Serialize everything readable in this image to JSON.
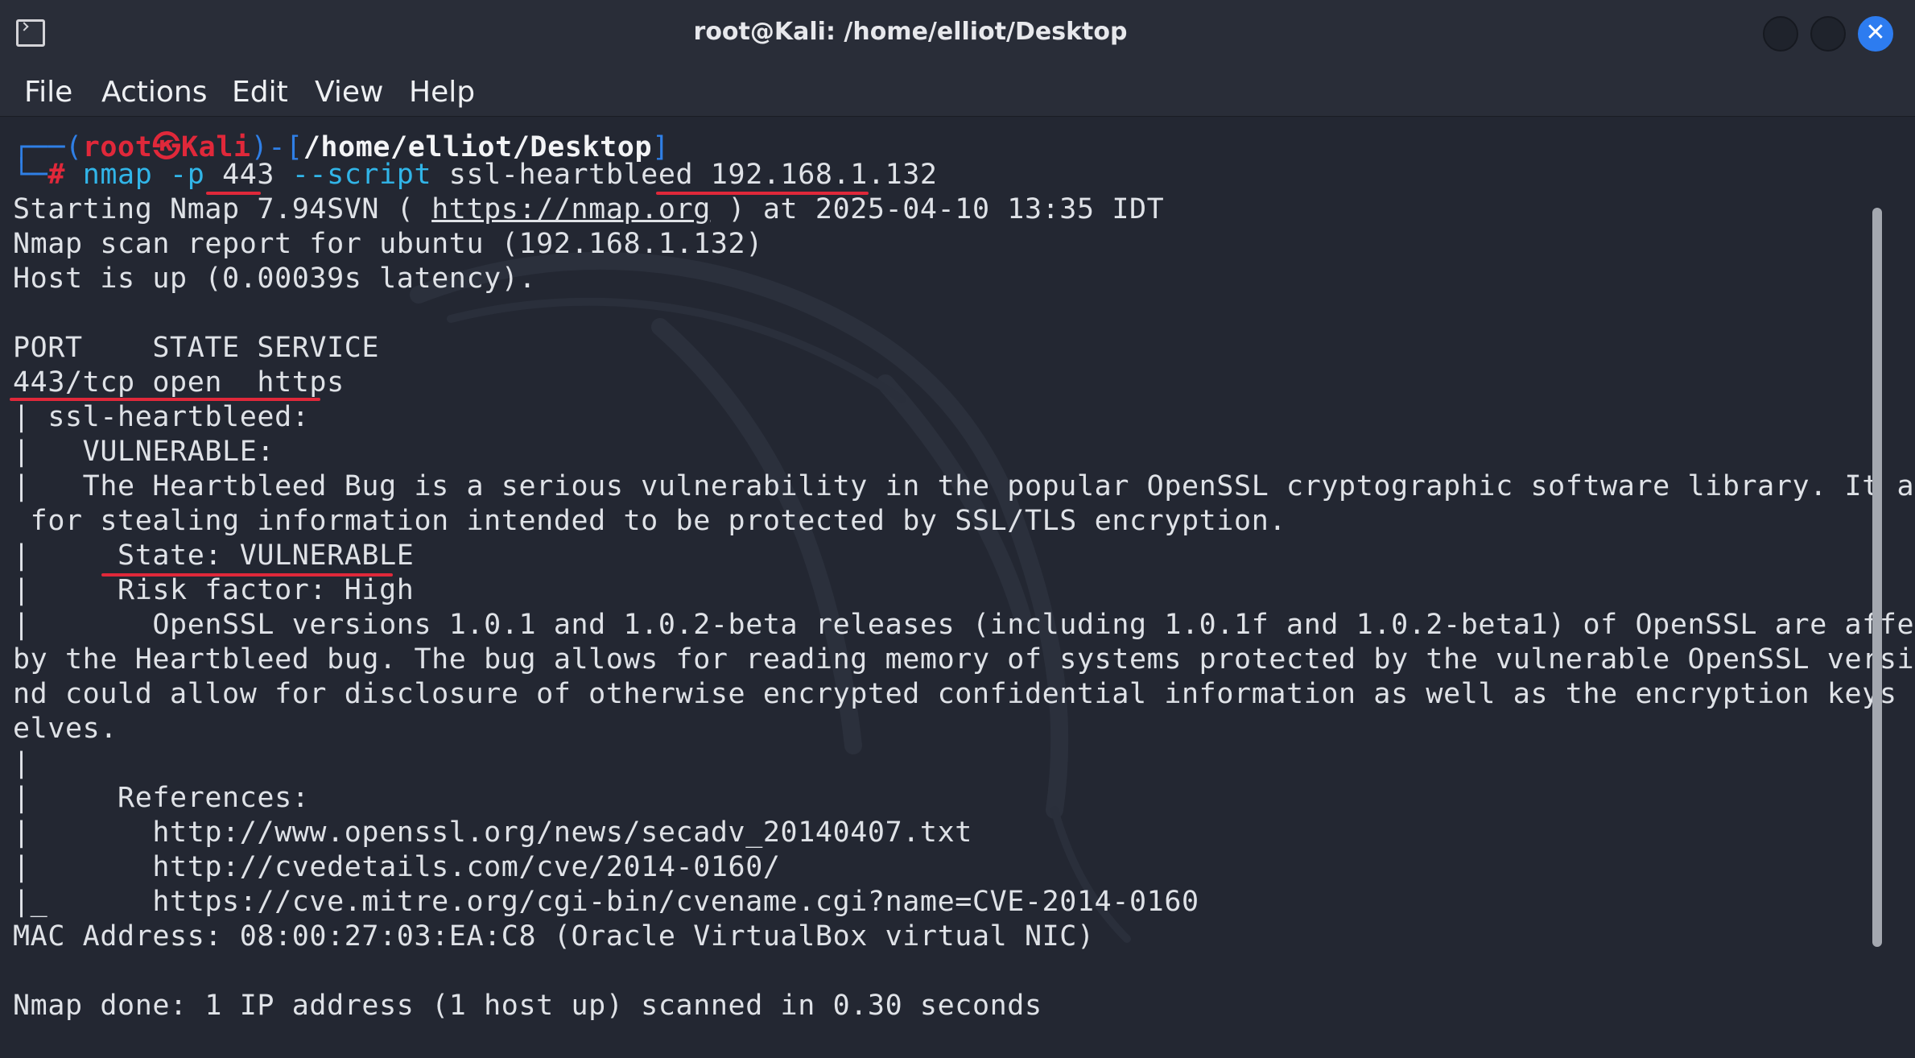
{
  "window": {
    "title": "root@Kali: /home/elliot/Desktop",
    "close_glyph": "✕"
  },
  "menu": {
    "items": [
      "File",
      "Actions",
      "Edit",
      "View",
      "Help"
    ]
  },
  "prompt": {
    "corner_top": "┌──(",
    "user": "root",
    "at_symbol": "㉿",
    "host": "Kali",
    "mid": ")-[",
    "cwd": "/home/elliot/Desktop",
    "end": "]",
    "corner_bottom": "└─",
    "hash": "#",
    "cmd": "nmap",
    "arg1": "-p",
    "port": "443",
    "arg2": "--script",
    "script": "ssl-heartbleed",
    "target": "192.168.1.132"
  },
  "output": {
    "start_pre": "Starting Nmap 7.94SVN ( ",
    "start_url": "https://nmap.org",
    "start_post": " ) at 2025-04-10 13:35 IDT",
    "lines": [
      "Nmap scan report for ubuntu (192.168.1.132)",
      "Host is up (0.00039s latency).",
      "",
      "PORT    STATE SERVICE",
      "443/tcp open  https",
      "| ssl-heartbleed: ",
      "|   VULNERABLE:",
      "|   The Heartbleed Bug is a serious vulnerability in the popular OpenSSL cryptographic software library. It allows",
      " for stealing information intended to be protected by SSL/TLS encryption.",
      "|     State: VULNERABLE",
      "|     Risk factor: High",
      "|       OpenSSL versions 1.0.1 and 1.0.2-beta releases (including 1.0.1f and 1.0.2-beta1) of OpenSSL are affected",
      "by the Heartbleed bug. The bug allows for reading memory of systems protected by the vulnerable OpenSSL versions a",
      "nd could allow for disclosure of otherwise encrypted confidential information as well as the encryption keys thems",
      "elves.",
      "|",
      "|     References:",
      "|       http://www.openssl.org/news/secadv_20140407.txt",
      "|       http://cvedetails.com/cve/2014-0160/",
      "|_      https://cve.mitre.org/cgi-bin/cvename.cgi?name=CVE-2014-0160",
      "MAC Address: 08:00:27:03:EA:C8 (Oracle VirtualBox virtual NIC)",
      "",
      "Nmap done: 1 IP address (1 host up) scanned in 0.30 seconds"
    ]
  },
  "colors": {
    "background": "#232732",
    "prompt_frame": "#2f7fe6",
    "prompt_user": "#e0283a",
    "command": "#31b5e8",
    "annotation": "#e0283a",
    "close_button": "#2d7cf0"
  }
}
